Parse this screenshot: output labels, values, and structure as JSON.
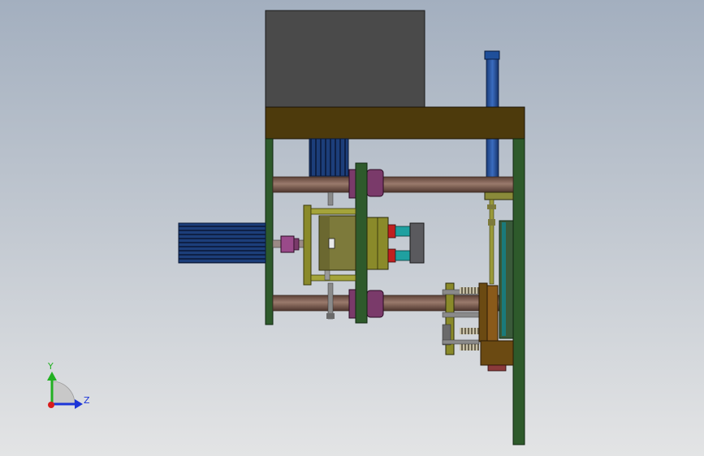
{
  "triad": {
    "y_label": "Y",
    "z_label": "Z",
    "y_color": "#22b022",
    "z_color": "#1c35d8",
    "x_color": "#d81c1c"
  },
  "colors": {
    "motor_housing": "#4a4a4a",
    "top_plate": "#4d3a0c",
    "frame_green": "#2e5a2b",
    "rod_brown": "#7a5a4e",
    "bearing_purple": "#7a3a6a",
    "blue_cylinder": "#1f4f9a",
    "bracket_olive": "#8a8a2a",
    "mold_block": "#7d7a3b",
    "fitting_red": "#c02020",
    "fitting_teal": "#1fa0a0",
    "block_gray": "#5a5a5e",
    "bracket_brown": "#6b4a12"
  }
}
